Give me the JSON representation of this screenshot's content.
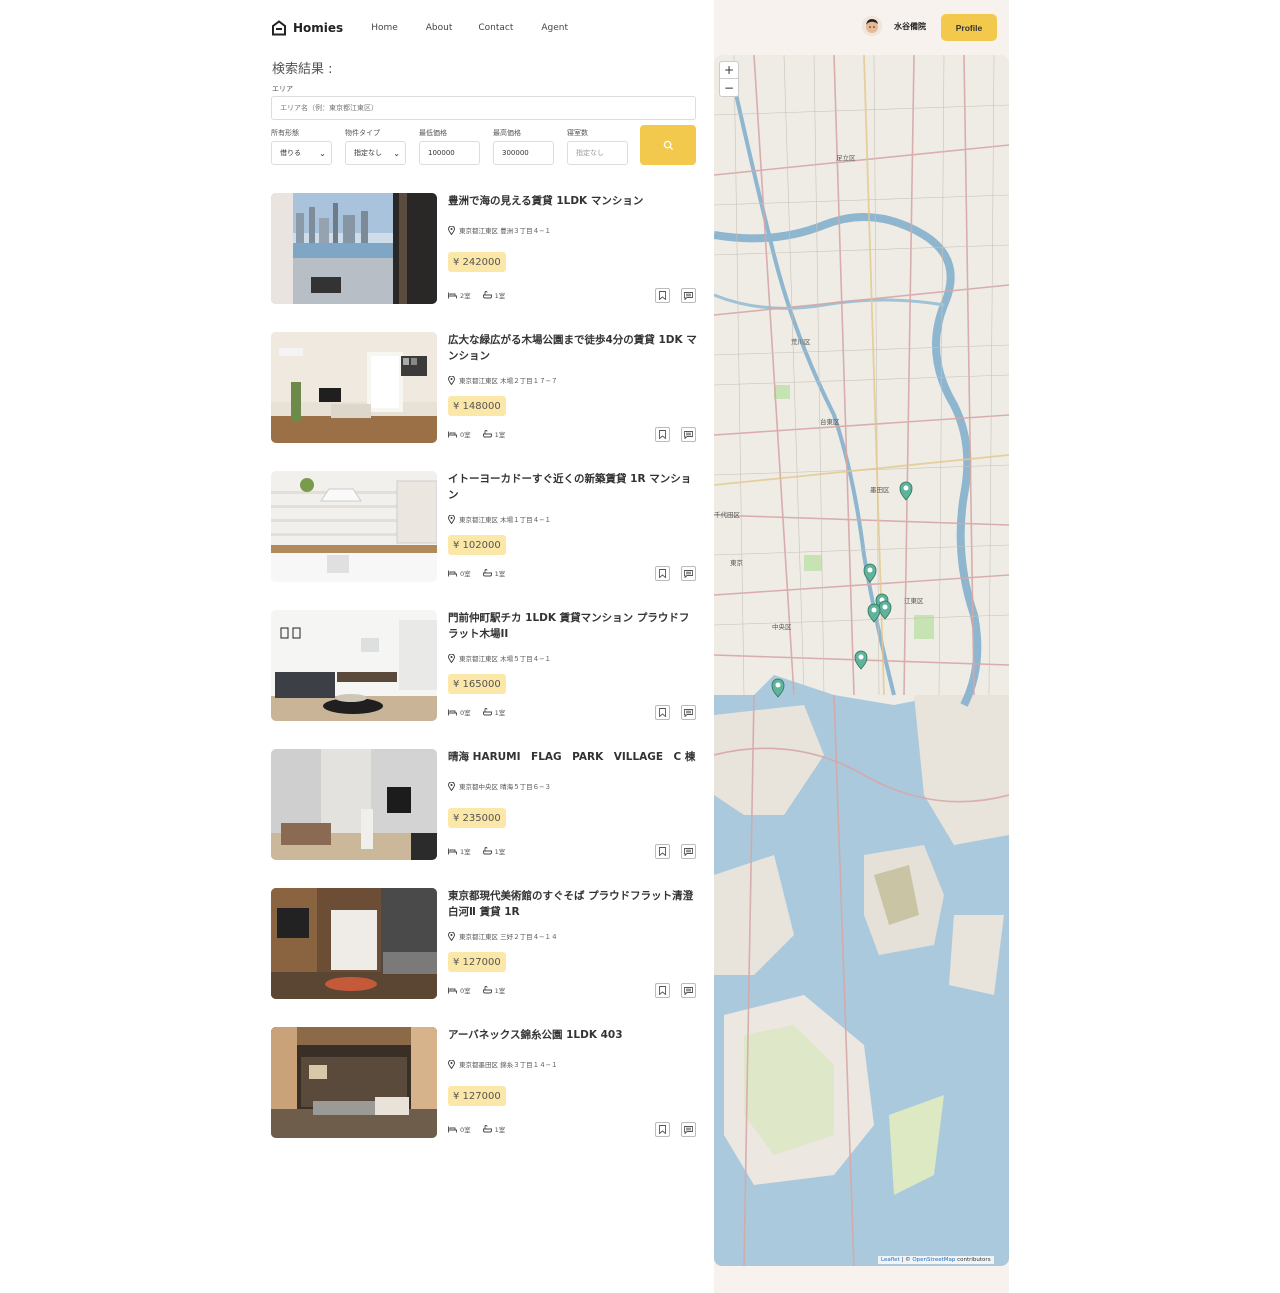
{
  "brand": {
    "name": "Homies"
  },
  "nav": [
    "Home",
    "About",
    "Contact",
    "Agent"
  ],
  "user": {
    "name": "水谷備院",
    "profile_label": "Profile"
  },
  "search": {
    "title": "検索結果 :",
    "area_label": "エリア",
    "area_placeholder": "エリア名（例：東京都江東区）",
    "filters": [
      {
        "label": "所有形態",
        "value": "借りる",
        "type": "select"
      },
      {
        "label": "物件タイプ",
        "value": "指定なし",
        "type": "select"
      },
      {
        "label": "最低価格",
        "value": "100000",
        "type": "input"
      },
      {
        "label": "最高価格",
        "value": "300000",
        "type": "input"
      },
      {
        "label": "寝室数",
        "value": "指定なし",
        "type": "placeholder"
      }
    ]
  },
  "listings": [
    {
      "title": "豊洲で海の見える賃貸 1LDK マンション",
      "address": "東京都江東区 豊洲３丁目４−１",
      "price": "¥ 242000",
      "bedrooms": "2室",
      "bathrooms": "1室"
    },
    {
      "title": "広大な緑広がる木場公園まで徒歩4分の賃貸 1DK マンション",
      "address": "東京都江東区 木場２丁目１７−７",
      "price": "¥ 148000",
      "bedrooms": "0室",
      "bathrooms": "1室"
    },
    {
      "title": "イトーヨーカドーすぐ近くの新築賃貸 1R マンション",
      "address": "東京都江東区 木場１丁目４−１",
      "price": "¥ 102000",
      "bedrooms": "0室",
      "bathrooms": "1室"
    },
    {
      "title": "門前仲町駅チカ 1LDK 賃貸マンション プラウドフラット木場II",
      "address": "東京都江東区 木場５丁目４−１",
      "price": "¥ 165000",
      "bedrooms": "0室",
      "bathrooms": "1室"
    },
    {
      "title": "晴海 HARUMI　FLAG　PARK　VILLAGE　C 棟",
      "address": "東京都中央区 晴海５丁目６−３",
      "price": "¥ 235000",
      "bedrooms": "1室",
      "bathrooms": "1室"
    },
    {
      "title": "東京都現代美術館のすぐそば プラウドフラット清澄白河Ⅱ 賃貸 1R",
      "address": "東京都江東区 三好２丁目４−１４",
      "price": "¥ 127000",
      "bedrooms": "0室",
      "bathrooms": "1室"
    },
    {
      "title": "アーバネックス錦糸公園 1LDK 403",
      "address": "東京都墨田区 錦糸３丁目１４−１",
      "price": "¥ 127000",
      "bedrooms": "0室",
      "bathrooms": "1室"
    }
  ],
  "map": {
    "zoom_in": "+",
    "zoom_out": "−",
    "attribution_leaflet": "Leaflet",
    "attribution_sep": " | © ",
    "attribution_osm": "OpenStreetMap",
    "attribution_tail": " contributors",
    "labels": [
      "足立区",
      "荒川区",
      "台東区",
      "墨田区",
      "江東区",
      "中央区",
      "東京",
      "千代田区"
    ]
  },
  "colors": {
    "accent": "#f2c94c",
    "price_bg": "#fbe7a7",
    "marker": "#5fb39a",
    "sea": "#aac9dd"
  }
}
